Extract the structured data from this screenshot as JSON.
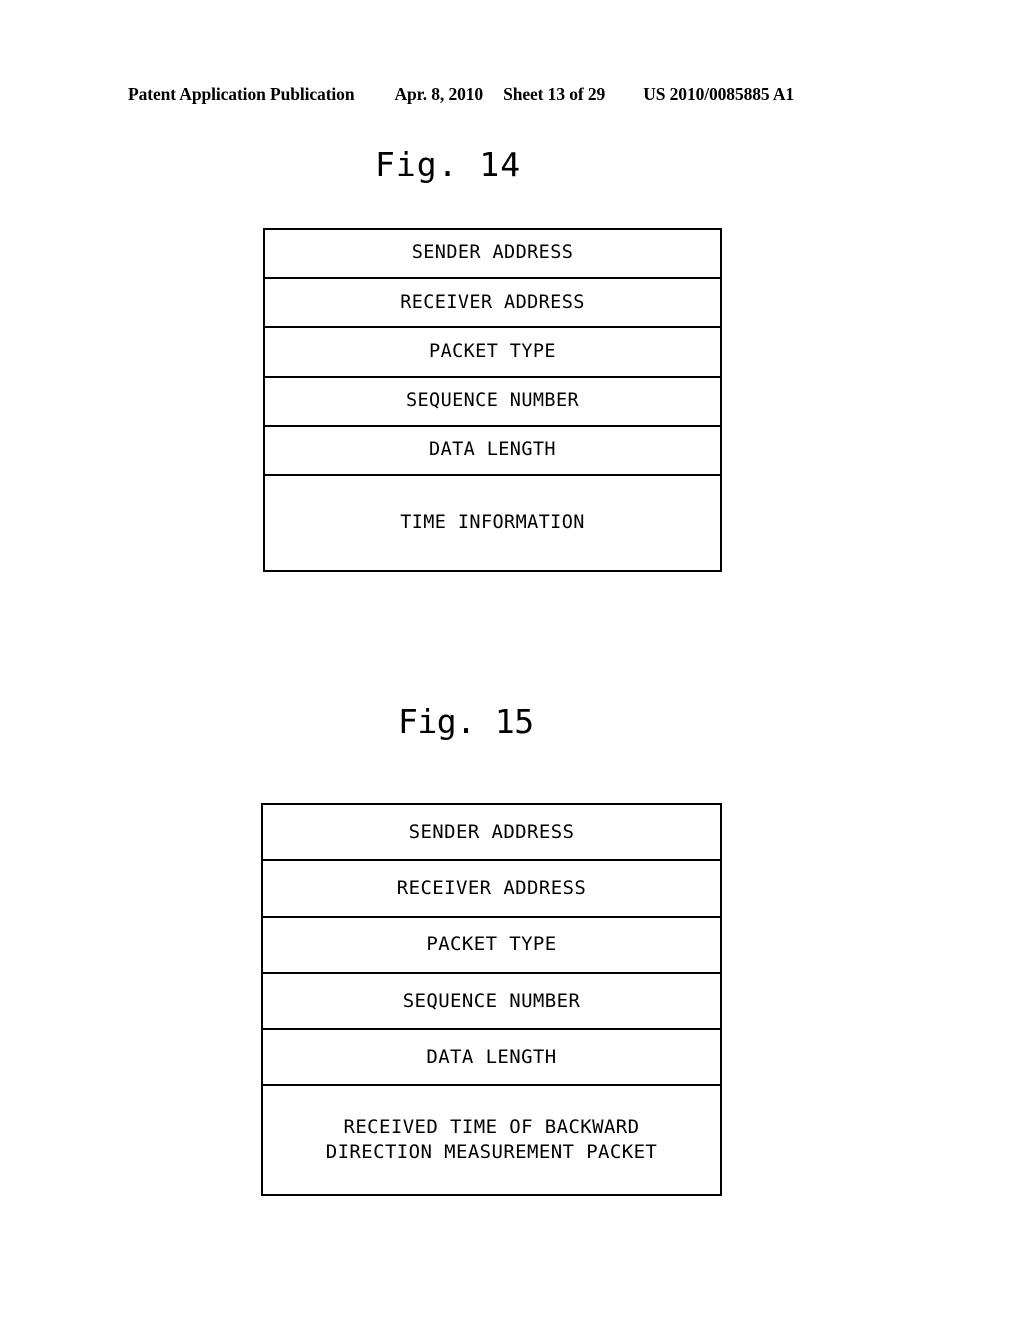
{
  "header": {
    "publication": "Patent Application Publication",
    "date": "Apr. 8, 2010",
    "sheet": "Sheet 13 of 29",
    "doc_number": "US 2010/0085885 A1"
  },
  "figures": [
    {
      "caption": "Fig. 14",
      "rows": [
        {
          "label": "SENDER ADDRESS",
          "tall": false
        },
        {
          "label": "RECEIVER ADDRESS",
          "tall": false
        },
        {
          "label": "PACKET TYPE",
          "tall": false
        },
        {
          "label": "SEQUENCE NUMBER",
          "tall": false
        },
        {
          "label": "DATA LENGTH",
          "tall": false
        },
        {
          "label": "TIME INFORMATION",
          "tall": true
        }
      ]
    },
    {
      "caption": "Fig. 15",
      "rows": [
        {
          "label": "SENDER ADDRESS",
          "tall": false
        },
        {
          "label": "RECEIVER ADDRESS",
          "tall": false
        },
        {
          "label": "PACKET TYPE",
          "tall": false
        },
        {
          "label": "SEQUENCE NUMBER",
          "tall": false
        },
        {
          "label": "DATA LENGTH",
          "tall": false
        },
        {
          "label": "RECEIVED TIME OF BACKWARD\nDIRECTION MEASUREMENT PACKET",
          "tall": true
        }
      ]
    }
  ],
  "colors": {
    "page_background": "#ffffff",
    "ink": "#000000"
  }
}
